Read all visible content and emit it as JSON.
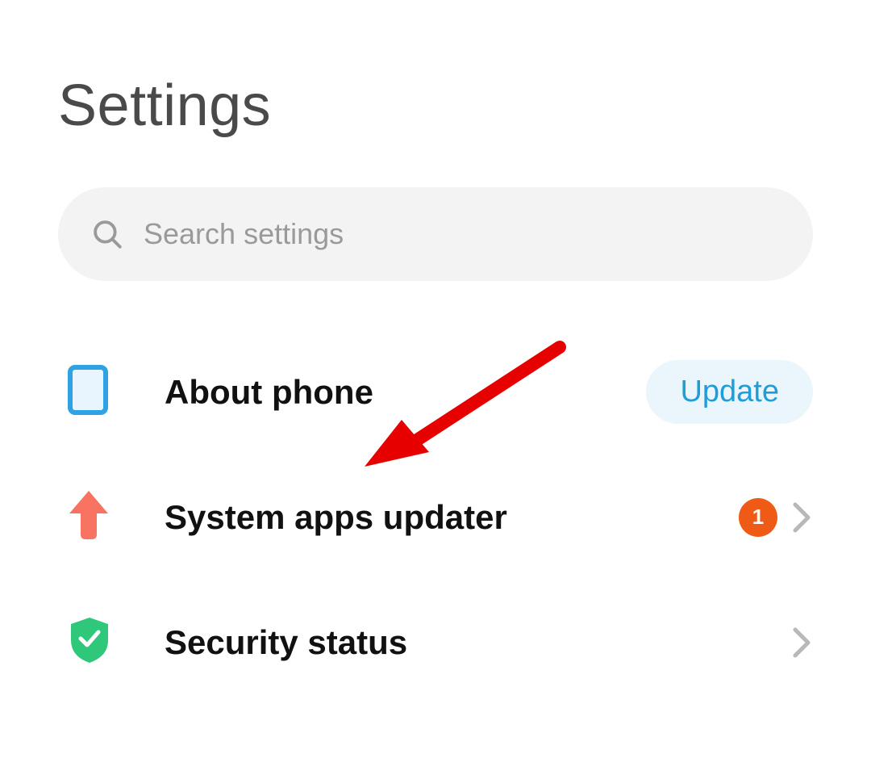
{
  "title": "Settings",
  "search": {
    "placeholder": "Search settings"
  },
  "rows": {
    "about": {
      "label": "About phone",
      "action": "Update"
    },
    "updater": {
      "label": "System apps updater",
      "badge": "1"
    },
    "security": {
      "label": "Security status"
    }
  }
}
